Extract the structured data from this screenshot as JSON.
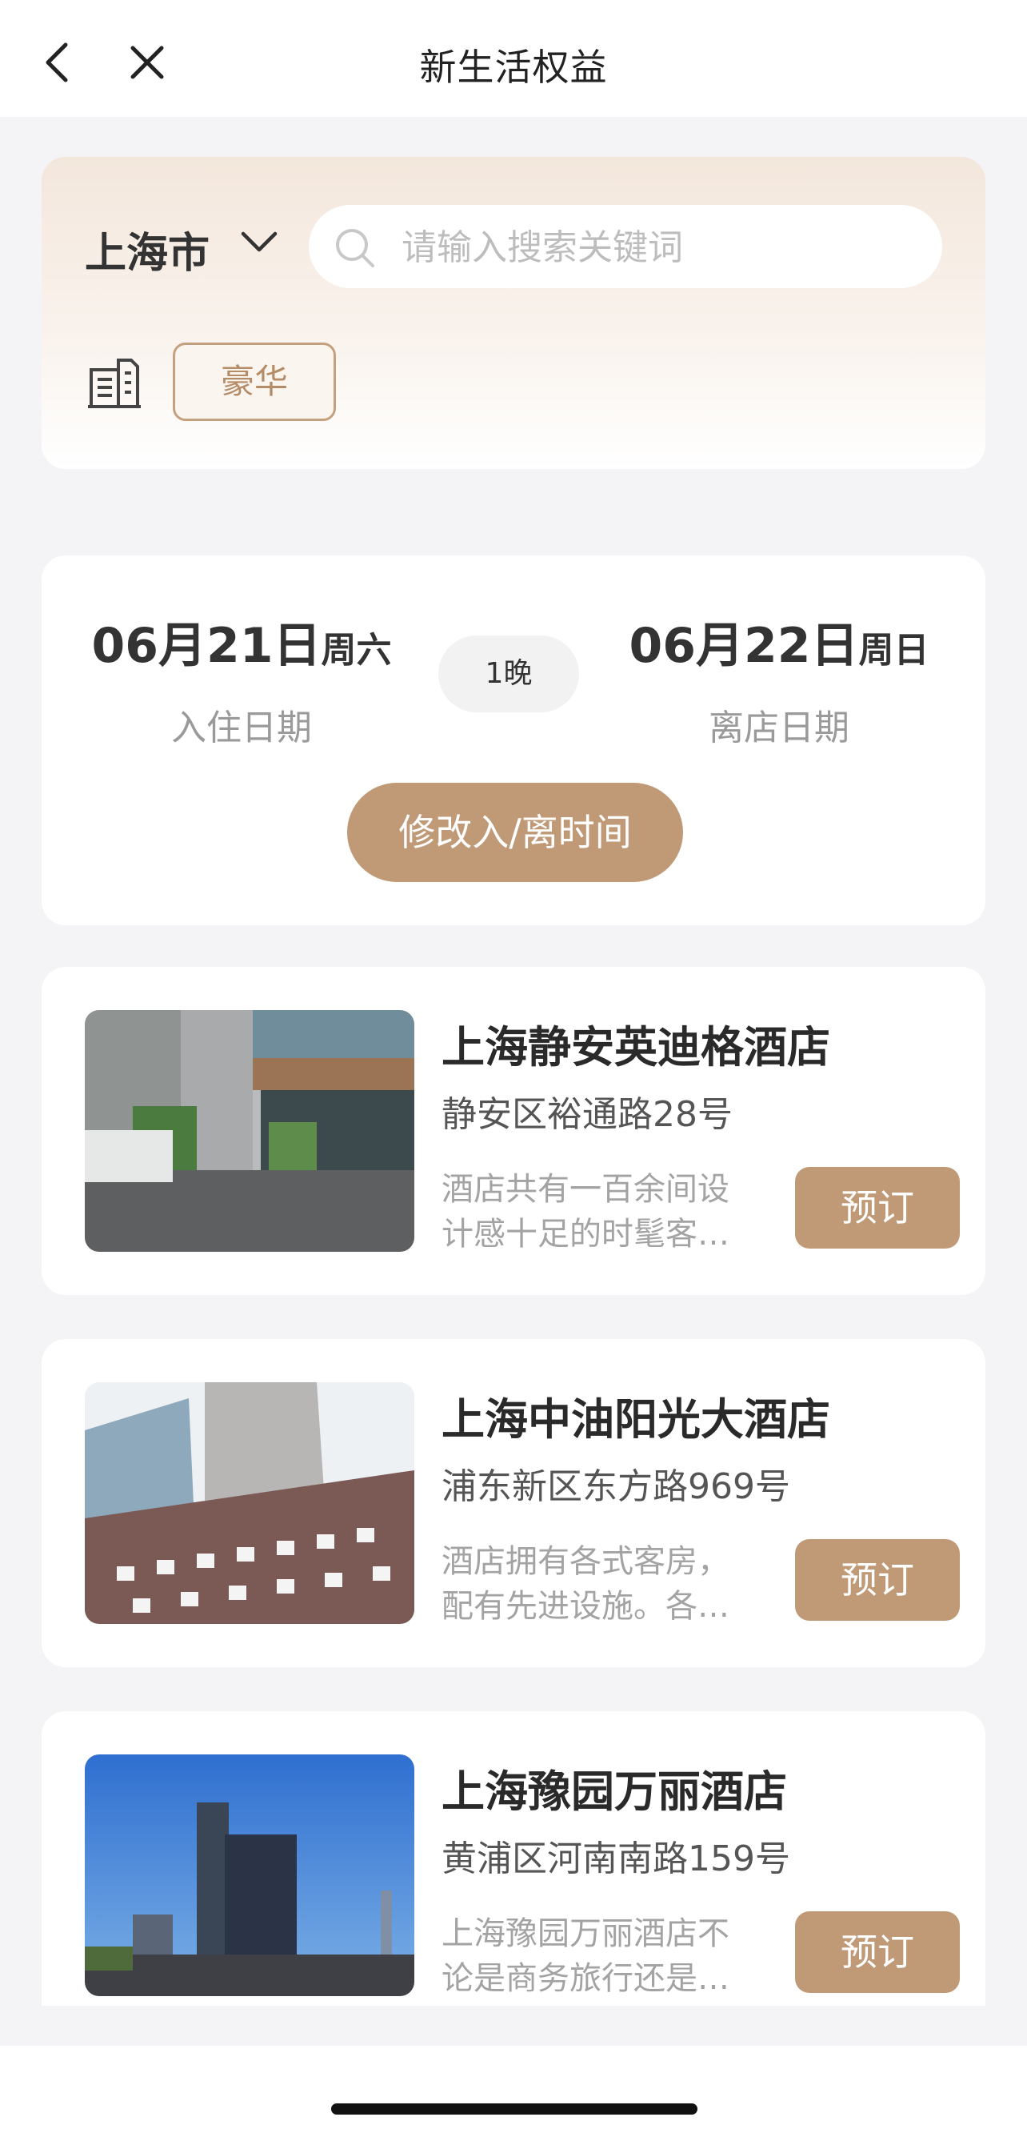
{
  "header": {
    "title": "新生活权益",
    "back_icon": "chevron-left-icon",
    "close_icon": "close-icon"
  },
  "search": {
    "city": "上海市",
    "placeholder": "请输入搜索关键词",
    "tag": "豪华"
  },
  "dates": {
    "checkin": {
      "date": "06月21日",
      "weekday": "周六",
      "label": "入住日期"
    },
    "checkout": {
      "date": "06月22日",
      "weekday": "周日",
      "label": "离店日期"
    },
    "nights": "1晚",
    "modify_label": "修改入/离时间"
  },
  "hotels": [
    {
      "name": "上海静安英迪格酒店",
      "address": "静安区裕通路28号",
      "description": "酒店共有一百余间设计感十足的时髦客…",
      "book_label": "预订"
    },
    {
      "name": "上海中油阳光大酒店",
      "address": "浦东新区东方路969号",
      "description": "酒店拥有各式客房，配有先进设施。各…",
      "book_label": "预订"
    },
    {
      "name": "上海豫园万丽酒店",
      "address": "黄浦区河南南路159号",
      "description": "上海豫园万丽酒店不论是商务旅行还是…",
      "book_label": "预订"
    }
  ],
  "colors": {
    "accent": "#c09a76",
    "tag_border": "#c4a07f",
    "background": "#f4f4f6"
  }
}
